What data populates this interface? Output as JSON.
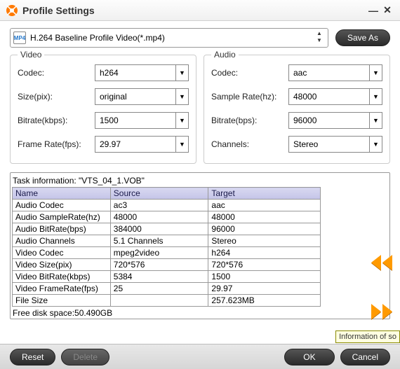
{
  "window": {
    "title": "Profile Settings"
  },
  "profile": {
    "name": "H.264 Baseline Profile Video(*.mp4)"
  },
  "buttons": {
    "saveAs": "Save As",
    "reset": "Reset",
    "delete": "Delete",
    "ok": "OK",
    "cancel": "Cancel"
  },
  "video": {
    "title": "Video",
    "codec": {
      "label": "Codec:",
      "value": "h264"
    },
    "size": {
      "label": "Size(pix):",
      "value": "original"
    },
    "bitrate": {
      "label": "Bitrate(kbps):",
      "value": "1500"
    },
    "framerate": {
      "label": "Frame Rate(fps):",
      "value": "29.97"
    }
  },
  "audio": {
    "title": "Audio",
    "codec": {
      "label": "Codec:",
      "value": "aac"
    },
    "samplerate": {
      "label": "Sample Rate(hz):",
      "value": "48000"
    },
    "bitrate": {
      "label": "Bitrate(bps):",
      "value": "96000"
    },
    "channels": {
      "label": "Channels:",
      "value": "Stereo"
    }
  },
  "task": {
    "header": "Task information: \"VTS_04_1.VOB\"",
    "columns": {
      "name": "Name",
      "source": "Source",
      "target": "Target"
    },
    "rows": [
      {
        "name": "Audio Codec",
        "source": "ac3",
        "target": "aac"
      },
      {
        "name": "Audio SampleRate(hz)",
        "source": "48000",
        "target": "48000"
      },
      {
        "name": "Audio BitRate(bps)",
        "source": "384000",
        "target": "96000"
      },
      {
        "name": "Audio Channels",
        "source": "5.1 Channels",
        "target": "Stereo"
      },
      {
        "name": "Video Codec",
        "source": "mpeg2video",
        "target": "h264"
      },
      {
        "name": "Video Size(pix)",
        "source": "720*576",
        "target": "720*576"
      },
      {
        "name": "Video BitRate(kbps)",
        "source": "5384",
        "target": "1500"
      },
      {
        "name": "Video FrameRate(fps)",
        "source": "25",
        "target": "29.97"
      },
      {
        "name": "File Size",
        "source": "",
        "target": "257.623MB"
      }
    ],
    "freedisk": "Free disk space:50.490GB"
  },
  "tooltip": "Information of so"
}
